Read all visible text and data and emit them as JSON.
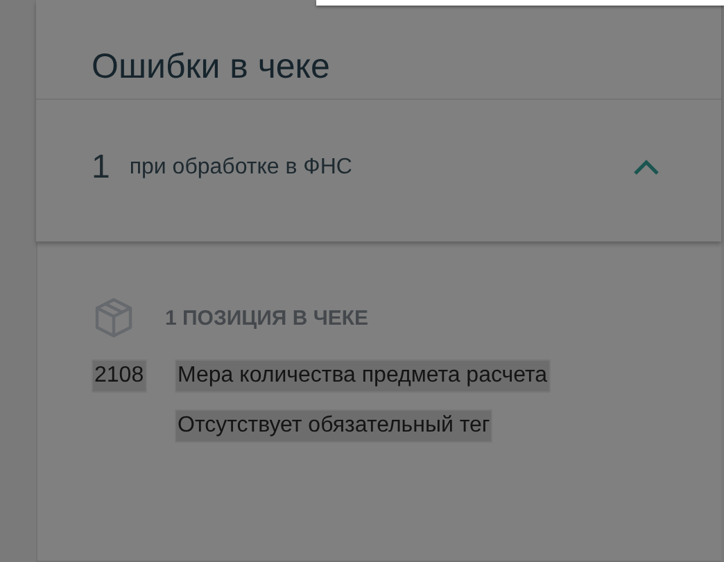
{
  "dialog": {
    "title": "Ошибки в чеке"
  },
  "error_group": {
    "count": "1",
    "label": "при обработке в ФНС",
    "expanded": true
  },
  "positions": {
    "heading": "1 ПОЗИЦИЯ В ЧЕКЕ",
    "items": [
      {
        "code": "2108",
        "code_highlighted": true,
        "name": "Мера количества предмета расчета",
        "name_highlighted": true,
        "message": "Отсутствует обязательный тег",
        "message_highlighted": true
      }
    ]
  }
}
